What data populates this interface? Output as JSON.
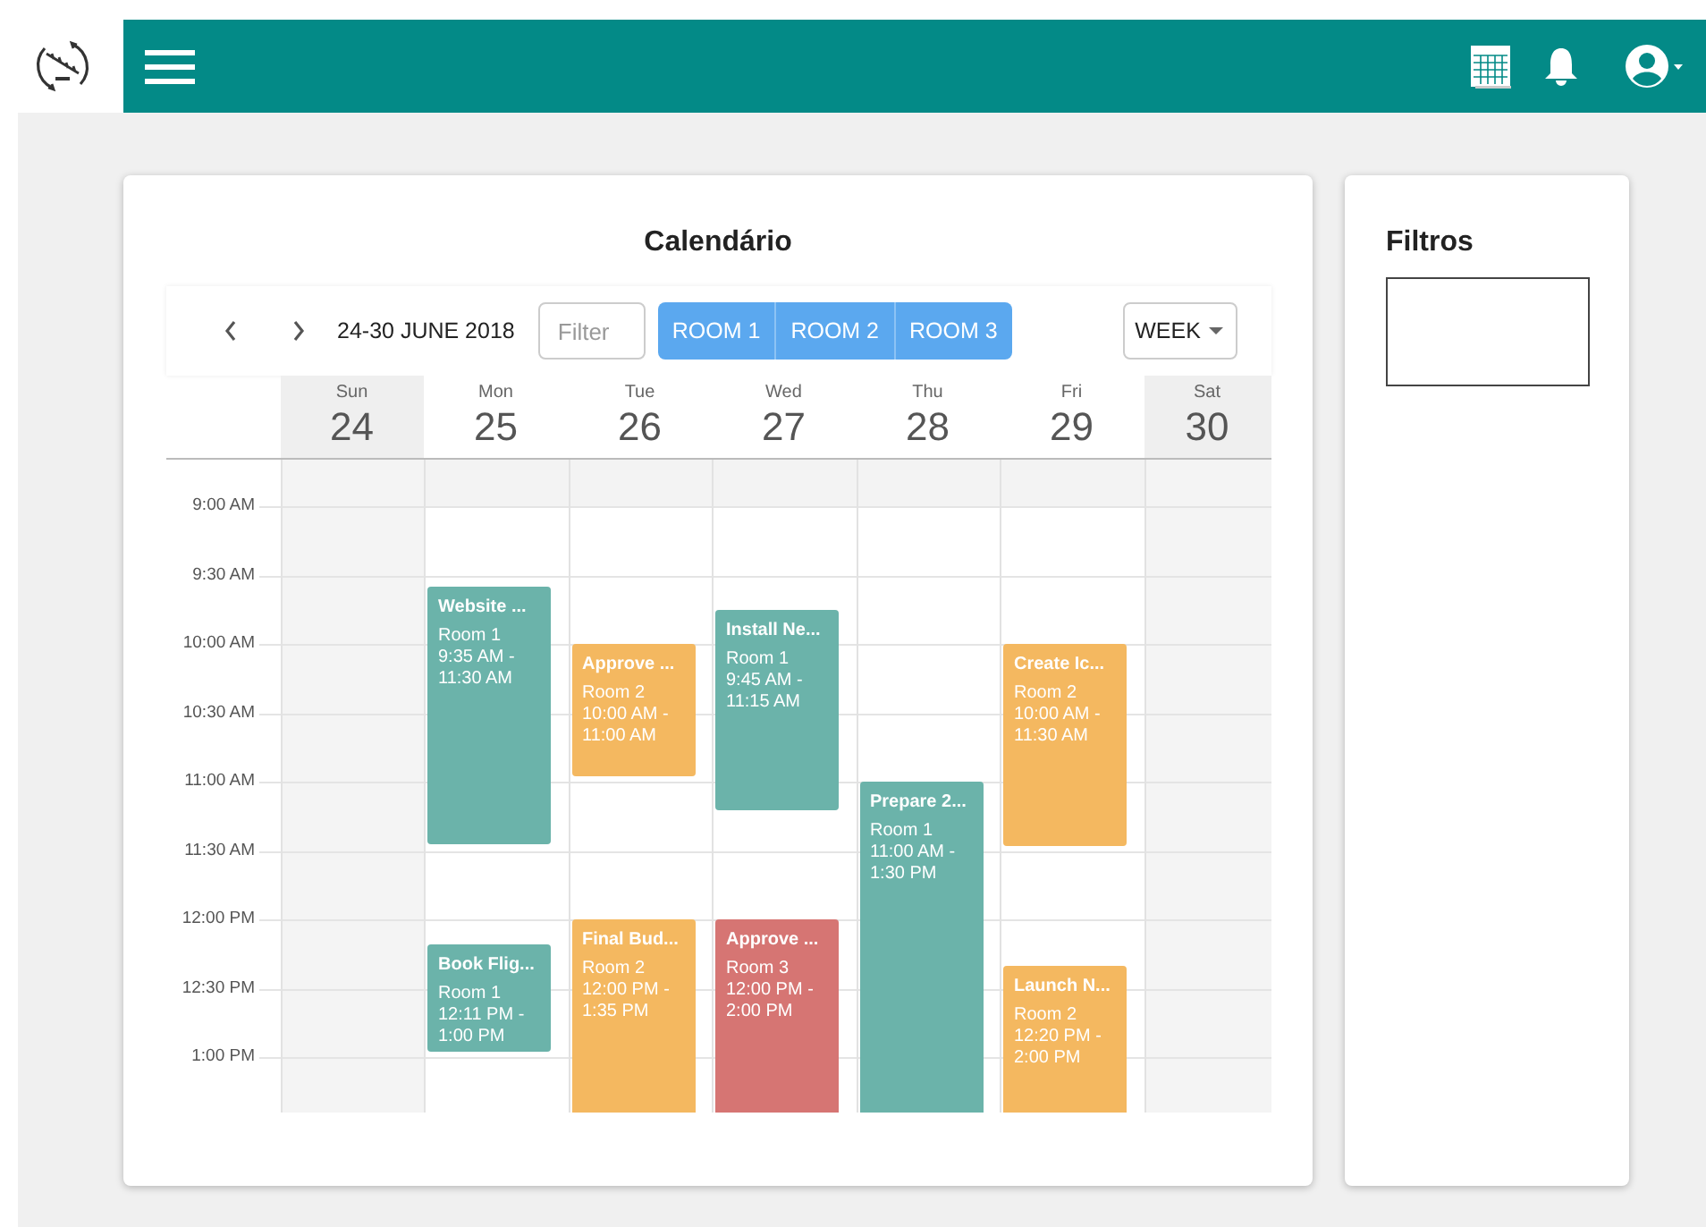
{
  "calendar": {
    "title": "Calendário",
    "toolbar": {
      "date_range": "24-30 JUNE 2018",
      "filter": {
        "placeholder": "Filter"
      },
      "rooms": [
        {
          "label": "ROOM 1"
        },
        {
          "label": "ROOM 2"
        },
        {
          "label": "ROOM 3"
        }
      ],
      "view": "WEEK"
    },
    "times": [
      "9:00 AM",
      "9:30 AM",
      "10:00 AM",
      "10:30 AM",
      "11:00 AM",
      "11:30 AM",
      "12:00 PM",
      "12:30 PM",
      "1:00 PM"
    ],
    "days": [
      {
        "name": "Sun",
        "number": "24",
        "weekend": true
      },
      {
        "name": "Mon",
        "number": "25",
        "weekend": false,
        "events": [
          {
            "title": "Website ...",
            "room": "Room 1",
            "time": "9:35 AM - 11:30 AM",
            "color": "#6bb3aa"
          },
          {
            "title": "Book Flig...",
            "room": "Room 1",
            "time": "12:11 PM - 1:00 PM",
            "color": "#6bb3aa"
          }
        ]
      },
      {
        "name": "Tue",
        "number": "26",
        "weekend": false,
        "events": [
          {
            "title": "Approve ...",
            "room": "Room 2",
            "time": "10:00 AM - 11:00 AM",
            "color": "#f4b860"
          },
          {
            "title": "Final Bud...",
            "room": "Room 2",
            "time": "12:00 PM - 1:35 PM",
            "color": "#f4b860"
          }
        ]
      },
      {
        "name": "Wed",
        "number": "27",
        "weekend": false,
        "events": [
          {
            "title": "Install Ne...",
            "room": "Room 1",
            "time": "9:45 AM - 11:15 AM",
            "color": "#6bb3aa"
          },
          {
            "title": "Approve ...",
            "room": "Room 3",
            "time": "12:00 PM - 2:00 PM",
            "color": "#d67573"
          }
        ]
      },
      {
        "name": "Thu",
        "number": "28",
        "weekend": false,
        "events": [
          {
            "title": "Prepare 2...",
            "room": "Room 1",
            "time": "11:00 AM - 1:30 PM",
            "color": "#6bb3aa"
          }
        ]
      },
      {
        "name": "Fri",
        "number": "29",
        "weekend": false,
        "events": [
          {
            "title": "Create Ic...",
            "room": "Room 2",
            "time": "10:00 AM - 11:30 AM",
            "color": "#f4b860"
          },
          {
            "title": "Launch N...",
            "room": "Room 2",
            "time": "12:20 PM - 2:00 PM",
            "color": "#f4b860"
          }
        ]
      },
      {
        "name": "Sat",
        "number": "30",
        "weekend": true
      }
    ]
  },
  "filters": {
    "title": "Filtros"
  }
}
